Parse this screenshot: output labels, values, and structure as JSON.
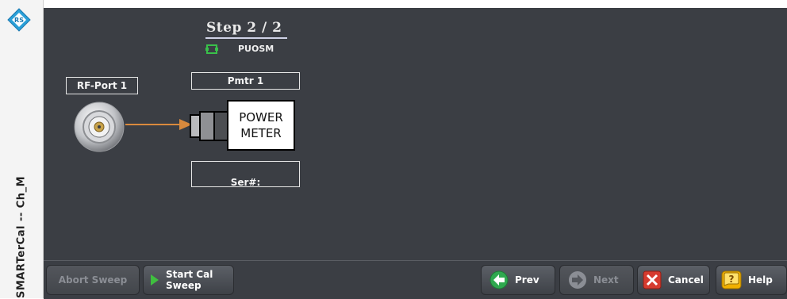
{
  "sidebar": {
    "title": "SMARTerCal -- Ch_M",
    "logo_text": "R&S"
  },
  "wizard": {
    "step_label": "Step 2 / 2",
    "standard_name": "PUOSM",
    "rf_port_label": "RF-Port 1",
    "power_meter_label": "Pmtr 1",
    "power_meter_box_line1": "POWER",
    "power_meter_box_line2": "METER",
    "serial_label": "Ser#:"
  },
  "footer": {
    "abort_label": "Abort Sweep",
    "start_cal_line1": "Start Cal",
    "start_cal_line2": "Sweep",
    "prev_label": "Prev",
    "next_label": "Next",
    "cancel_label": "Cancel",
    "help_label": "Help"
  },
  "colors": {
    "panel_bg": "#3b3e44",
    "arrow": "#d98a3d",
    "start_icon": "#3fbf3f",
    "prev_icon": "#2fa84f",
    "cancel_icon": "#d63b2f",
    "help_icon": "#f0b000",
    "puosm_icon": "#39c04a"
  }
}
